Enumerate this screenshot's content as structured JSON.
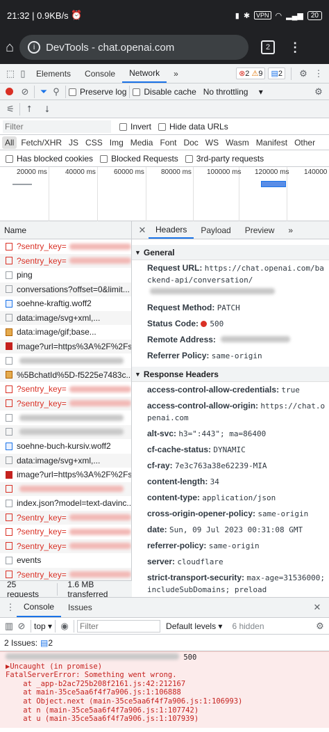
{
  "status": {
    "time": "21:32",
    "speed": "0.9KB/s",
    "vpn": "VPN",
    "battery": "20"
  },
  "browser": {
    "url": "DevTools - chat.openai.com",
    "tab_count": "2"
  },
  "devtools": {
    "tabs": [
      "Elements",
      "Console",
      "Network"
    ],
    "more_tabs": "»",
    "errors": "2",
    "warnings": "9",
    "messages": "2"
  },
  "network": {
    "preserve_log": "Preserve log",
    "disable_cache": "Disable cache",
    "throttling": "No throttling",
    "filter_placeholder": "Filter",
    "invert": "Invert",
    "hide_data_urls": "Hide data URLs",
    "types": [
      "All",
      "Fetch/XHR",
      "JS",
      "CSS",
      "Img",
      "Media",
      "Font",
      "Doc",
      "WS",
      "Wasm",
      "Manifest",
      "Other"
    ],
    "has_blocked_cookies": "Has blocked cookies",
    "blocked_requests": "Blocked Requests",
    "third_party": "3rd-party requests",
    "ticks": [
      "20000 ms",
      "40000 ms",
      "60000 ms",
      "80000 ms",
      "100000 ms",
      "120000 ms",
      "140000"
    ],
    "name_header": "Name",
    "requests": [
      {
        "name": "?sentry_key=",
        "type": "red",
        "err": true
      },
      {
        "name": "?sentry_key=",
        "type": "red",
        "err": true
      },
      {
        "name": "ping",
        "type": "doc",
        "err": false
      },
      {
        "name": "conversations?offset=0&limit...",
        "type": "doc",
        "err": false
      },
      {
        "name": "soehne-kraftig.woff2",
        "type": "font",
        "err": false
      },
      {
        "name": "data:image/svg+xml,...",
        "type": "doc",
        "err": false
      },
      {
        "name": "data:image/gif;base...",
        "type": "gif",
        "err": false
      },
      {
        "name": "image?url=https%3A%2F%2Fs...",
        "type": "img",
        "err": false
      },
      {
        "name": "",
        "type": "doc",
        "err": false
      },
      {
        "name": "%5BchatId%5D-f5225e7483c...",
        "type": "gif",
        "err": false
      },
      {
        "name": "?sentry_key=",
        "type": "red",
        "err": true
      },
      {
        "name": "?sentry_key=",
        "type": "red",
        "err": true
      },
      {
        "name": "",
        "type": "doc",
        "err": false
      },
      {
        "name": "",
        "type": "doc",
        "err": false
      },
      {
        "name": "soehne-buch-kursiv.woff2",
        "type": "font",
        "err": false
      },
      {
        "name": "data:image/svg+xml,...",
        "type": "doc",
        "err": false
      },
      {
        "name": "image?url=https%3A%2F%2Fs...",
        "type": "img",
        "err": false
      },
      {
        "name": "",
        "type": "red",
        "err": true
      },
      {
        "name": "index.json?model=text-davinc...",
        "type": "doc",
        "err": false
      },
      {
        "name": "?sentry_key=",
        "type": "red",
        "err": true
      },
      {
        "name": "?sentry_key=",
        "type": "red",
        "err": true
      },
      {
        "name": "?sentry_key=",
        "type": "red",
        "err": true
      },
      {
        "name": "events",
        "type": "doc",
        "err": false
      },
      {
        "name": "?sentry_key=",
        "type": "red",
        "err": true
      }
    ],
    "footer_requests": "25 requests",
    "footer_transferred": "1.6 MB transferred"
  },
  "detail": {
    "tabs": [
      "Headers",
      "Payload",
      "Preview"
    ],
    "general_title": "General",
    "general": [
      {
        "k": "Request URL:",
        "v": "https://chat.openai.com/backend-api/conversation/"
      },
      {
        "k": "Request Method:",
        "v": "PATCH"
      },
      {
        "k": "Status Code:",
        "v": "500"
      },
      {
        "k": "Remote Address:",
        "v": ""
      },
      {
        "k": "Referrer Policy:",
        "v": "same-origin"
      }
    ],
    "response_title": "Response Headers",
    "response": [
      {
        "k": "access-control-allow-credentials:",
        "v": "true"
      },
      {
        "k": "access-control-allow-origin:",
        "v": "https://chat.openai.com"
      },
      {
        "k": "alt-svc:",
        "v": "h3=\":443\"; ma=86400"
      },
      {
        "k": "cf-cache-status:",
        "v": "DYNAMIC"
      },
      {
        "k": "cf-ray:",
        "v": "7e3c763a38e62239-MIA"
      },
      {
        "k": "content-length:",
        "v": "34"
      },
      {
        "k": "content-type:",
        "v": "application/json"
      },
      {
        "k": "cross-origin-opener-policy:",
        "v": "same-origin"
      },
      {
        "k": "date:",
        "v": "Sun, 09 Jul 2023 00:31:08 GMT"
      },
      {
        "k": "referrer-policy:",
        "v": "same-origin"
      },
      {
        "k": "server:",
        "v": "cloudflare"
      },
      {
        "k": "strict-transport-security:",
        "v": "max-age=31536000; includeSubDomains; preload"
      },
      {
        "k": "vary:",
        "v": "Origin"
      },
      {
        "k": "x-content-type-options:",
        "v": "nosniff"
      }
    ]
  },
  "drawer": {
    "tabs": [
      "Console",
      "Issues"
    ],
    "context": "top",
    "filter_placeholder": "Filter",
    "levels": "Default levels",
    "hidden": "6 hidden",
    "issues_label": "2 Issues:",
    "issues_count": "2",
    "error_head_tail": "500",
    "error_lines": [
      "▶Uncaught (in promise)",
      "FatalServerError: Something went wrong.",
      "    at _app-b2ac725b208f2161.js:42:212167",
      "    at main-35ce5aa6f4f7a906.js:1:106888",
      "    at Object.next (main-35ce5aa6f4f7a906.js:1:106993)",
      "    at n (main-35ce5aa6f4f7a906.js:1:107742)",
      "    at u (main-35ce5aa6f4f7a906.js:1:107939)"
    ]
  },
  "colors": {
    "accent": "#1a73e8",
    "error": "#d93025"
  }
}
